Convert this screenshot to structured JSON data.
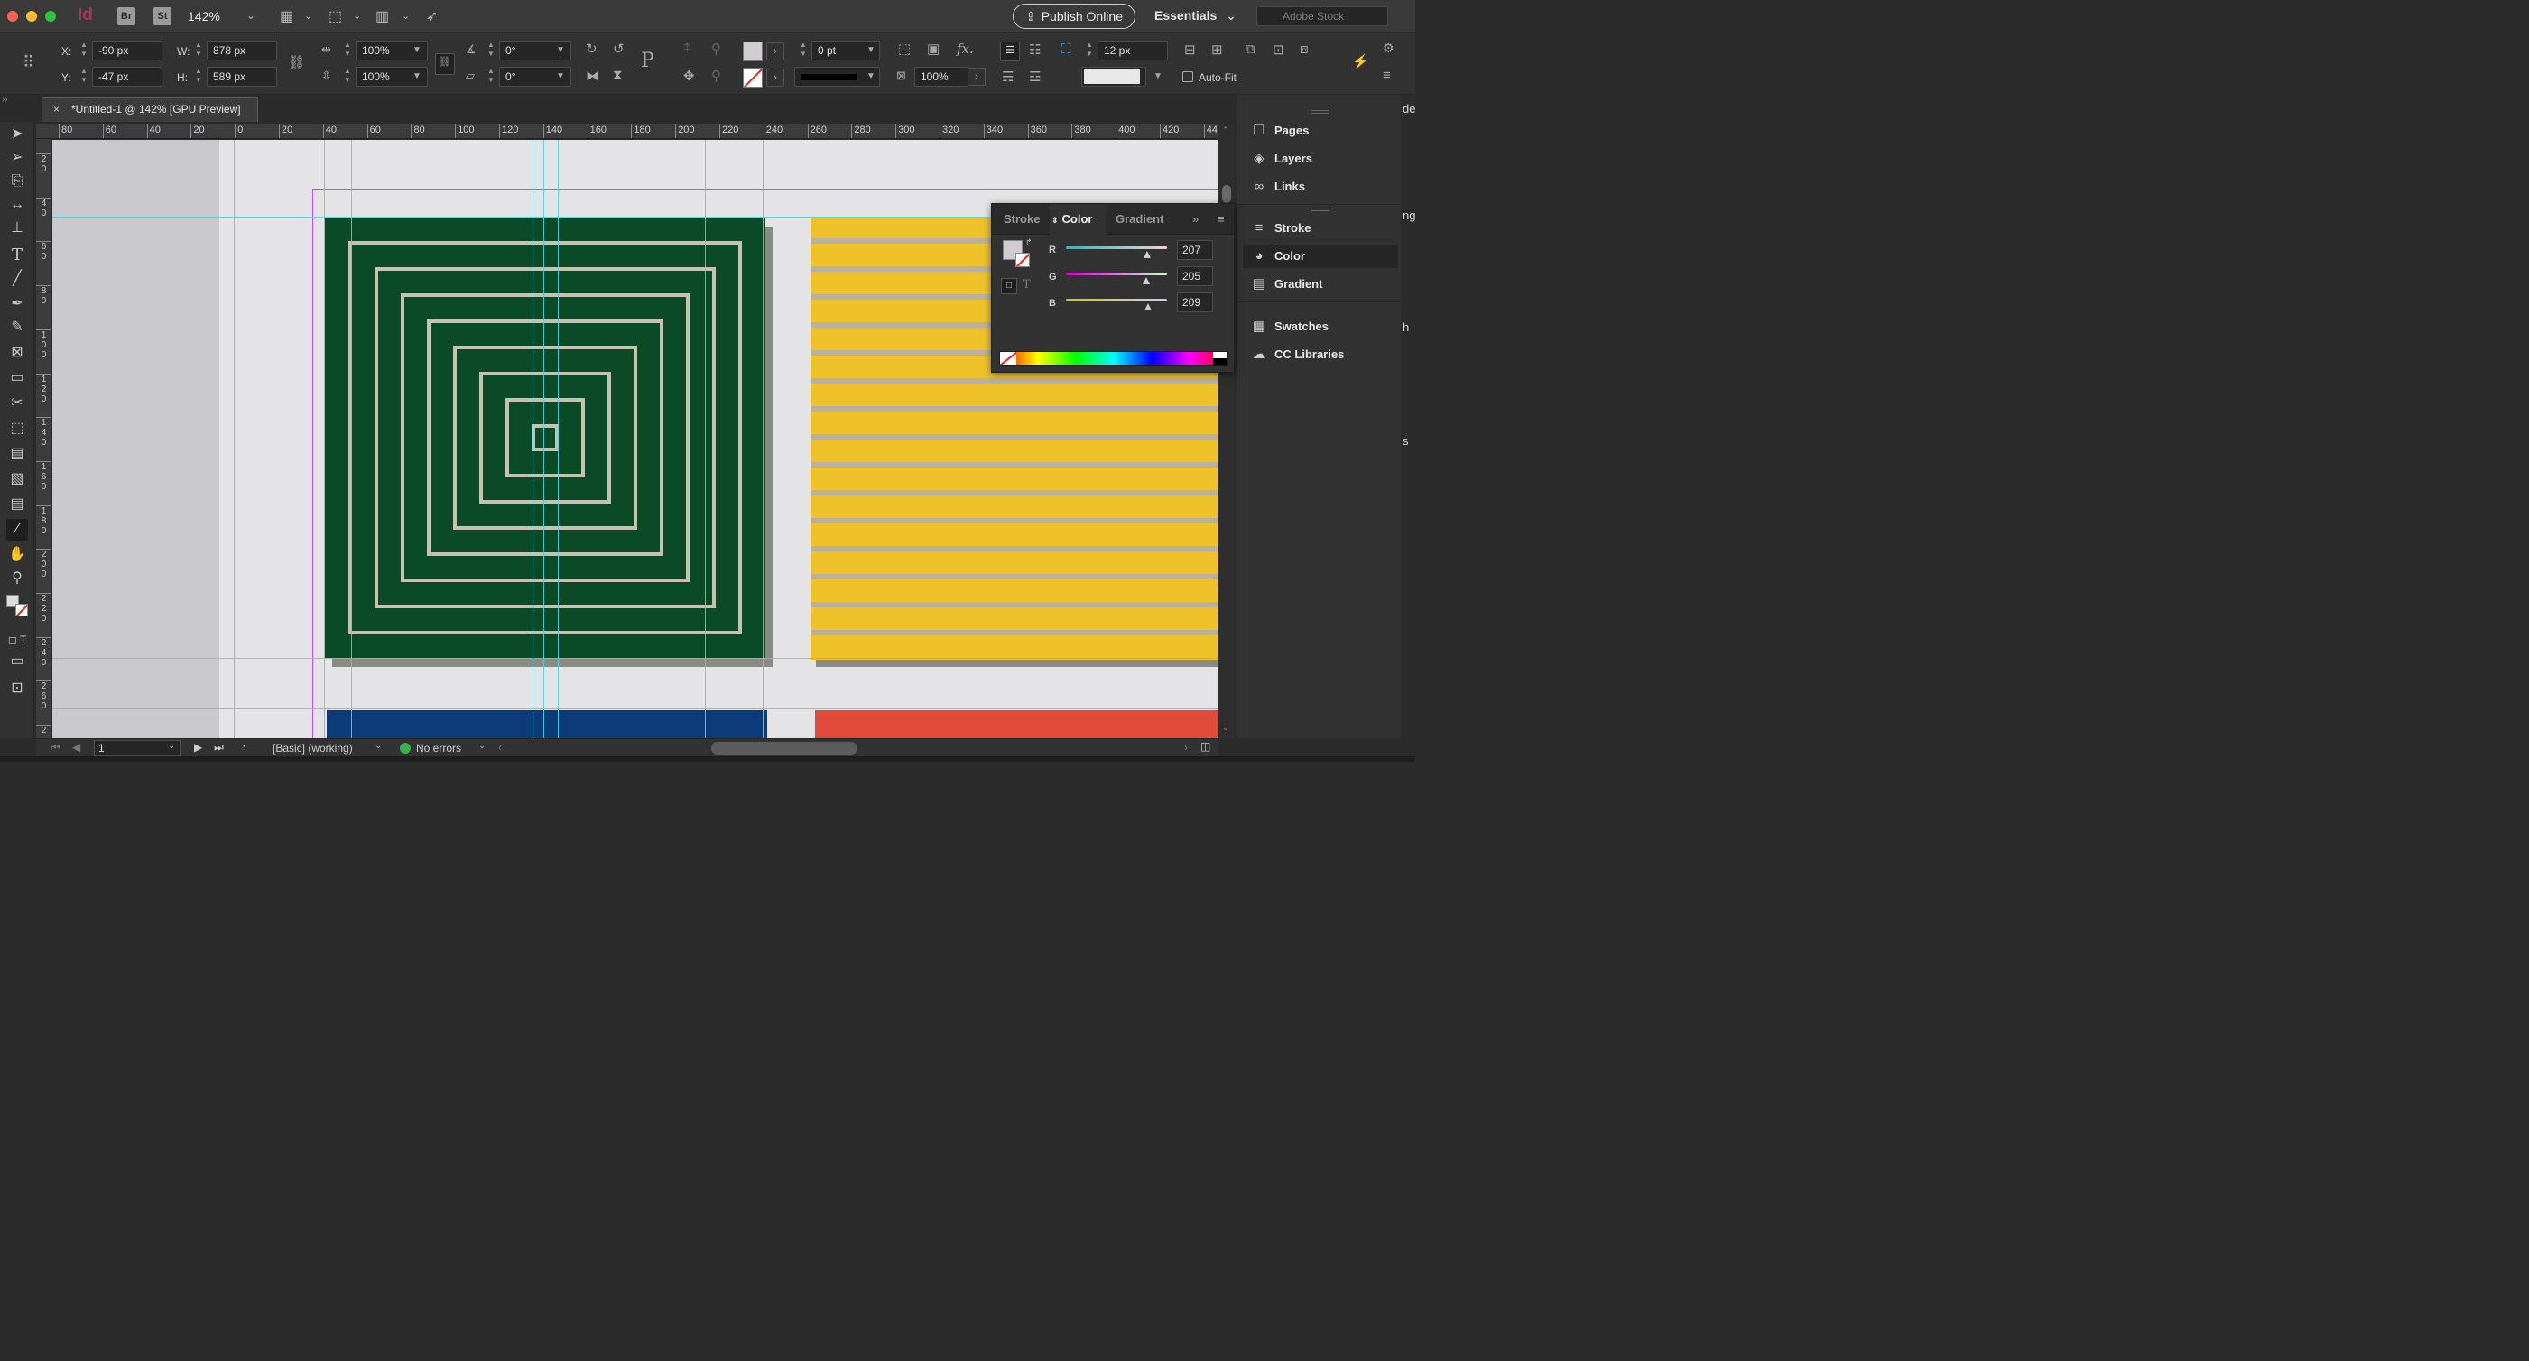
{
  "app": {
    "logo": "Id",
    "bridge": "Br",
    "stock": "St",
    "zoom": "142%",
    "publish": "Publish Online",
    "workspace": "Essentials",
    "search_placeholder": "Adobe Stock"
  },
  "control": {
    "x_label": "X:",
    "x_value": "-90 px",
    "y_label": "Y:",
    "y_value": "-47 px",
    "w_label": "W:",
    "w_value": "878 px",
    "h_label": "H:",
    "h_value": "589 px",
    "scale_x": "100%",
    "scale_y": "100%",
    "rotate": "0°",
    "shear": "0°",
    "stroke_weight": "0 pt",
    "opacity": "100%",
    "gutter": "12 px",
    "autofit": "Auto-Fit"
  },
  "tab": {
    "close": "×",
    "title": "*Untitled-1 @ 142% [GPU Preview]"
  },
  "ruler": {
    "top": [
      "80",
      "60",
      "40",
      "20",
      "0",
      "20",
      "40",
      "60",
      "80",
      "100",
      "120",
      "140",
      "160",
      "180",
      "200",
      "220",
      "240",
      "260",
      "280",
      "300",
      "320",
      "340",
      "360",
      "380",
      "400",
      "420",
      "44"
    ],
    "left": [
      "2 0",
      "4 0",
      "6 0",
      "8 0",
      "1 0 0",
      "1 2 0",
      "1 4 0",
      "1 6 0",
      "1 8 0",
      "2 0 0",
      "2 2 0",
      "2 4 0",
      "2 6 0",
      "2"
    ]
  },
  "status": {
    "page": "1",
    "style": "[Basic] (working)",
    "preflight": "No errors"
  },
  "dock": {
    "items": [
      {
        "label": "Pages",
        "icon": "pages-icon",
        "glyph": "❐"
      },
      {
        "label": "Layers",
        "icon": "layers-icon",
        "glyph": "◈"
      },
      {
        "label": "Links",
        "icon": "links-icon",
        "glyph": "∞"
      },
      {
        "label": "Stroke",
        "icon": "stroke-icon",
        "glyph": "≡"
      },
      {
        "label": "Color",
        "icon": "color-icon",
        "glyph": "◕"
      },
      {
        "label": "Gradient",
        "icon": "gradient-icon",
        "glyph": "▤"
      },
      {
        "label": "Swatches",
        "icon": "swatches-icon",
        "glyph": "▦"
      },
      {
        "label": "CC Libraries",
        "icon": "cc-libraries-icon",
        "glyph": "☁"
      }
    ],
    "edge_text": [
      "de",
      "ng",
      "h",
      "s"
    ]
  },
  "color_panel": {
    "tabs": [
      "Stroke",
      "Color",
      "Gradient"
    ],
    "r_label": "R",
    "r": "207",
    "g_label": "G",
    "g": "205",
    "b_label": "B",
    "b": "209",
    "t_label": "T"
  },
  "colors": {
    "fill_swatch": "#cfcdd1",
    "green_tile": "#0a4a27",
    "yellow_tile": "#efc22a",
    "guide": "#46d5e6",
    "margin": "#c24cff"
  }
}
